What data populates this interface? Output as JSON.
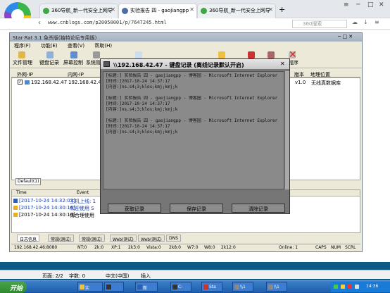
{
  "browser": {
    "tabs": [
      {
        "label": "360导航_新一代安全上网导"
      },
      {
        "label": "实验报告 四 - gaojiangpp"
      },
      {
        "label": "360导航_新一代安全上网导"
      }
    ],
    "new_tab": "+",
    "url": "www.cnblogs.com/p20050001/p/7647245.html",
    "search_placeholder": "360搜索"
  },
  "app": {
    "title": "Star Rat 3.1 免杀版(独特论坛专用版)",
    "menu": [
      "程序(F)",
      "功能(E)",
      "查看(V)",
      "帮助(H)"
    ],
    "toolbar": [
      "文件管理",
      "键盘记录",
      "屏幕控制",
      "系统管理",
      "出程序"
    ],
    "list_headers": [
      "外网-IP",
      "内网-IP",
      "版本",
      "地理位置"
    ],
    "row": {
      "wan": "192.168.42.47",
      "lan": "192.168.42.47",
      "version": "v1.0",
      "location": "无线真数据库"
    },
    "tab_default": "Default(1)",
    "log_headers": [
      "Time",
      "Event"
    ],
    "logs": [
      {
        "time": "[2017-10-24 14:32:03]",
        "msg": "主机上线: 1"
      },
      {
        "time": "[2017-10-24 14:30:16]",
        "msg": "欢迎使用 S"
      },
      {
        "time": "[2017-10-24 14:30:16]",
        "msg": "请合理使用"
      }
    ],
    "log_tabs": [
      "日志信息",
      "常规(测试)",
      "常规(测试)",
      "Web(测试)",
      "Web(测试)",
      "DNS"
    ],
    "status": {
      "ip": "192.168.42.46:8080",
      "nt": "NT:0",
      "k2": "2k:0",
      "xp": "XP:1",
      "k3": "2k3:0",
      "vista": "Vista:0",
      "k8": "2k8:0",
      "w7": "W7:0",
      "w8": "W8:0",
      "k12": "2k12:0",
      "online": "Online: 1",
      "caps": "CAPS",
      "num": "NUM",
      "scrl": "SCRL"
    }
  },
  "dialog": {
    "title": "\\\\192.168.42.47 - 键盘记录 (离线记录默认开启)",
    "lines": [
      "[标题:] 实验报告 四 - gaojiangpp - 博客园 - Microsoft Internet Explorer",
      "[时间:]2017-10-24  14:37:17",
      "[内容:]ns.s4;3;klos;kmj;kmj;k",
      "",
      "[标题:] 实验报告 四 - gaojiangpp - 博客园 - Microsoft Internet Explorer",
      "[时间:]2017-10-24  14:37:17",
      "[内容:]ns.s4;3;klos;kmj;kmj;k",
      "",
      "[标题:] 实验报告 四 - gaojiangpp - 博客园 - Microsoft Internet Explorer",
      "[时间:]2017-10-24  14:37:17",
      "[内容:]ns.s4;3;klos;kmj;kmj;k"
    ],
    "buttons": [
      "获取记录",
      "保存记录",
      "清除记录"
    ]
  },
  "word": {
    "page": "页面: 2/2",
    "words": "字数: 0",
    "lang": "中文(中国)",
    "mode": "插入"
  },
  "taskbar": {
    "start": "开始",
    "items": [
      "实",
      "",
      "新",
      "C:",
      "Sta",
      "\\\\1",
      "\\\\1"
    ],
    "clock": "14:36"
  },
  "colors": {
    "accent": "#3aa845",
    "dialog": "#767676",
    "taskbar": "#1f5fad"
  }
}
